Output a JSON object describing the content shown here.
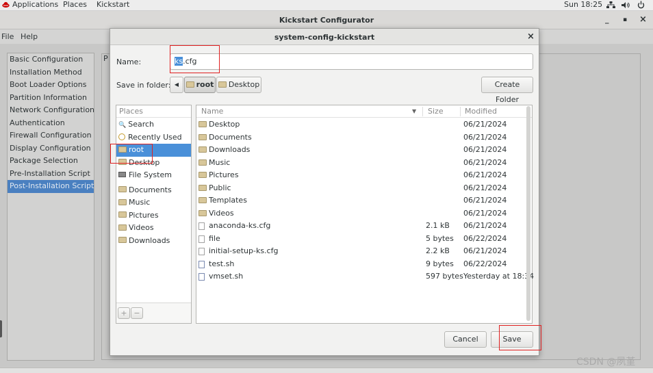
{
  "topbar": {
    "applications": "Applications",
    "places": "Places",
    "kickstart": "Kickstart",
    "clock": "Sun 18:25"
  },
  "window": {
    "title": "Kickstart Configurator",
    "minimize": "_",
    "maximize": "▪",
    "close": "×"
  },
  "menubar": {
    "file": "File",
    "help": "Help"
  },
  "sidebar": {
    "items": [
      "Basic Configuration",
      "Installation Method",
      "Boot Loader Options",
      "Partition Information",
      "Network Configuration",
      "Authentication",
      "Firewall Configuration",
      "Display Configuration",
      "Package Selection",
      "Pre-Installation Script",
      "Post-Installation Script"
    ],
    "selected": "Post-Installation Script"
  },
  "main": {
    "header_letter": "P"
  },
  "dialog": {
    "title": "system-config-kickstart",
    "close": "×",
    "name_label": "Name:",
    "name_selected": "ks",
    "name_rest": ".cfg",
    "save_in_label": "Save in folder:",
    "path": [
      "root",
      "Desktop"
    ],
    "create_folder": "Create Folder",
    "cancel": "Cancel",
    "save": "Save",
    "places_header": "Places",
    "places": [
      {
        "label": "Search",
        "icon": "search-icon"
      },
      {
        "label": "Recently Used",
        "icon": "clock-icon"
      },
      {
        "label": "root",
        "icon": "folder-icon",
        "selected": true
      },
      {
        "label": "Desktop",
        "icon": "folder-icon"
      },
      {
        "label": "File System",
        "icon": "drive-icon"
      },
      {
        "label": "Documents",
        "icon": "folder-icon"
      },
      {
        "label": "Music",
        "icon": "folder-icon"
      },
      {
        "label": "Pictures",
        "icon": "folder-icon"
      },
      {
        "label": "Videos",
        "icon": "folder-icon"
      },
      {
        "label": "Downloads",
        "icon": "folder-icon"
      }
    ],
    "places_add": "+",
    "places_remove": "−",
    "columns": {
      "name": "Name",
      "size": "Size",
      "modified": "Modified"
    },
    "files": [
      {
        "name": "Desktop",
        "size": "",
        "modified": "06/21/2024",
        "type": "folder"
      },
      {
        "name": "Documents",
        "size": "",
        "modified": "06/21/2024",
        "type": "folder"
      },
      {
        "name": "Downloads",
        "size": "",
        "modified": "06/21/2024",
        "type": "folder"
      },
      {
        "name": "Music",
        "size": "",
        "modified": "06/21/2024",
        "type": "folder"
      },
      {
        "name": "Pictures",
        "size": "",
        "modified": "06/21/2024",
        "type": "folder"
      },
      {
        "name": "Public",
        "size": "",
        "modified": "06/21/2024",
        "type": "folder"
      },
      {
        "name": "Templates",
        "size": "",
        "modified": "06/21/2024",
        "type": "folder"
      },
      {
        "name": "Videos",
        "size": "",
        "modified": "06/21/2024",
        "type": "folder"
      },
      {
        "name": "anaconda-ks.cfg",
        "size": "2.1 kB",
        "modified": "06/21/2024",
        "type": "file"
      },
      {
        "name": "file",
        "size": "5 bytes",
        "modified": "06/22/2024",
        "type": "file"
      },
      {
        "name": "initial-setup-ks.cfg",
        "size": "2.2 kB",
        "modified": "06/21/2024",
        "type": "file"
      },
      {
        "name": "test.sh",
        "size": "9 bytes",
        "modified": "06/22/2024",
        "type": "script"
      },
      {
        "name": "vmset.sh",
        "size": "597 bytes",
        "modified": "Yesterday at 18:34",
        "type": "script"
      }
    ]
  },
  "watermark": "CSDN @夙堇",
  "colors": {
    "selection": "#4a90d9",
    "sidebar_selected": "#4a80c0",
    "annotation": "#e02020"
  }
}
